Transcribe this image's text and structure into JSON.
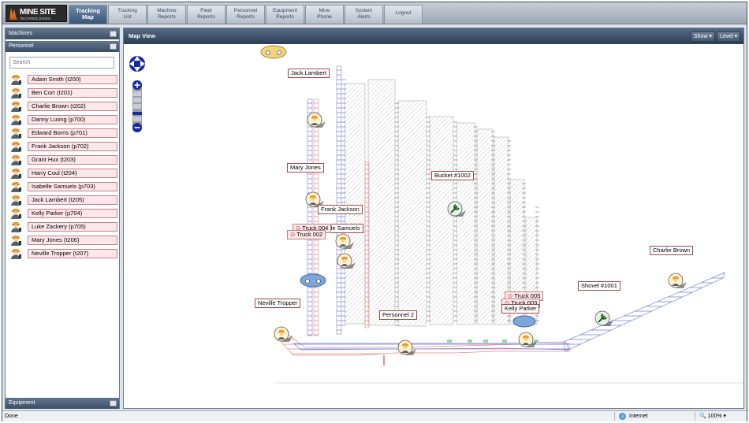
{
  "brand": {
    "name": "MINE SITE",
    "sub": "TECHNOLOGIES"
  },
  "nav": [
    {
      "label_1": "Tracking",
      "label_2": "Map",
      "active": true
    },
    {
      "label_1": "Tracking",
      "label_2": "List"
    },
    {
      "label_1": "Machine",
      "label_2": "Reports"
    },
    {
      "label_1": "Fleet",
      "label_2": "Reports"
    },
    {
      "label_1": "Personnel",
      "label_2": "Reports"
    },
    {
      "label_1": "Equipment",
      "label_2": "Reports"
    },
    {
      "label_1": "Mine",
      "label_2": "Phone"
    },
    {
      "label_1": "System",
      "label_2": "Alerts"
    },
    {
      "label_1": "Logout",
      "label_2": ""
    }
  ],
  "sidebar": {
    "machines_title": "Machines",
    "personnel_title": "Personnel",
    "search_placeholder": "Search",
    "personnel": [
      "Adam Smith (t200)",
      "Ben Corr (t201)",
      "Charlie Brown (t202)",
      "Danny Luong (p700)",
      "Edward Borris (p701)",
      "Frank Jackson (p702)",
      "Grant Hux (t203)",
      "Harry Coul (t204)",
      "Isabelle Samuels (p703)",
      "Jack Lambert (t205)",
      "Kelly Parker (p704)",
      "Luke Zackery (p705)",
      "Mary Jones (t206)",
      "Neville Tropper (t207)"
    ],
    "equipment_title": "Equipment"
  },
  "map": {
    "title": "Map View",
    "show_btn": "Show",
    "level_btn": "Level",
    "markers": [
      {
        "label": "Jack Lambert"
      },
      {
        "label": "Mary Jones"
      },
      {
        "label": "Frank Jackson"
      },
      {
        "label": "lle Samuels"
      },
      {
        "label": "Truck 004"
      },
      {
        "label": "Truck 002"
      },
      {
        "label": "Bucket #1002"
      },
      {
        "label": "Neville Tropper"
      },
      {
        "label": "Personnel  2"
      },
      {
        "label": "Truck 005"
      },
      {
        "label": "Truck 003"
      },
      {
        "label": "Kelly Parker"
      },
      {
        "label": "Shovel #1001"
      },
      {
        "label": "Charlie Brown"
      }
    ]
  },
  "status": {
    "left": "Done",
    "zone": "Internet",
    "zoom": "100%"
  },
  "colors": {
    "accent": "#3a5678",
    "person_bg": "#fde7ea",
    "person_border": "#c77f89"
  }
}
